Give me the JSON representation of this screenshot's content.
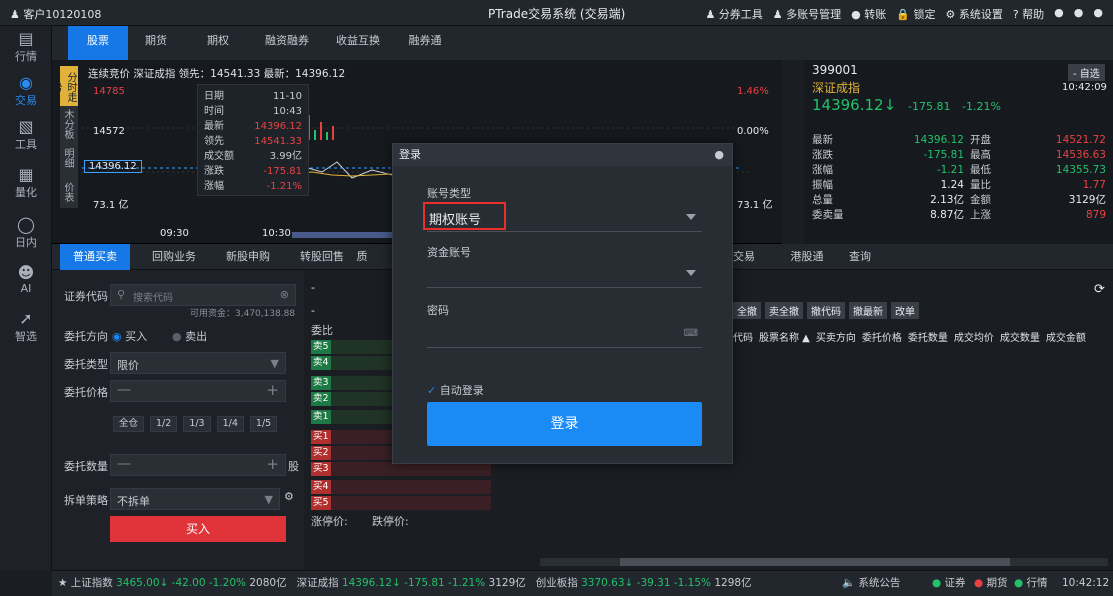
{
  "titlebar": {
    "account": "客户10120108",
    "title": "PTrade交易系统 (交易端)",
    "tools": [
      "分券工具",
      "多账号管理",
      "转账",
      "锁定",
      "系统设置",
      "帮助"
    ]
  },
  "nav": {
    "items": [
      {
        "label": "行情",
        "icon": "chart-icon"
      },
      {
        "label": "交易",
        "icon": "trade-icon"
      },
      {
        "label": "工具",
        "icon": "toolbox-icon"
      },
      {
        "label": "量化",
        "icon": "quant-icon"
      },
      {
        "label": "日内",
        "icon": "intraday-icon"
      },
      {
        "label": "AI",
        "icon": "ai-icon"
      },
      {
        "label": "智选",
        "icon": "smart-icon"
      }
    ]
  },
  "tabs": [
    "股票",
    "期货",
    "期权",
    "融资融券",
    "收益互换",
    "融券通"
  ],
  "chart": {
    "header": "连续竞价  深证成指  领先：14541.33  最新：14396.12",
    "vtabs": [
      "分时走势",
      "木分板",
      "明细",
      "价表"
    ],
    "levels": {
      "high": "14785",
      "mid": "14572",
      "cur": "14396.12",
      "vol": "73.1 亿",
      "pct_high": "1.46%",
      "pct_mid": "0.00%",
      "pct_cur": "1.21%",
      "vol_r": "73.1 亿"
    },
    "times": [
      "09:30",
      "10:30"
    ]
  },
  "tooltip": {
    "rows": [
      [
        "日期",
        "11-10"
      ],
      [
        "时间",
        "10:43"
      ],
      [
        "最新",
        "14396.12"
      ],
      [
        "领先",
        "14541.33"
      ],
      [
        "成交额",
        "3.99亿"
      ],
      [
        "涨跌",
        "-175.81"
      ],
      [
        "涨幅",
        "-1.21%"
      ]
    ]
  },
  "quote": {
    "code": "399001",
    "name": "深证成指",
    "btn": "- 自选",
    "time": "10:42:09",
    "price": "14396.12↓",
    "change": "-175.81",
    "pct": "-1.21%",
    "rows": [
      [
        "最新",
        "14396.12",
        "开盘",
        "14521.72"
      ],
      [
        "涨跌",
        "-175.81",
        "最高",
        "14536.63"
      ],
      [
        "涨幅",
        "-1.21",
        "最低",
        "14355.73"
      ],
      [
        "振幅",
        "1.24",
        "量比",
        "1.77"
      ],
      [
        "总量",
        "2.13亿",
        "金额",
        "3129亿"
      ],
      [
        "委卖量",
        "8.87亿",
        "上涨",
        "879"
      ]
    ]
  },
  "ordertabs": [
    "普通买卖",
    "回购业务",
    "新股申购",
    "转股回售",
    "质",
    "交易",
    "港股通",
    "查询"
  ],
  "form": {
    "code_label": "证券代码",
    "search_placeholder": "搜索代码",
    "avail": "可用资金：3,470,138.88",
    "dir_label": "委托方向",
    "buy": "买入",
    "sell": "卖出",
    "type_label": "委托类型",
    "type_value": "限价",
    "price_label": "委托价格",
    "fractions": [
      "全仓",
      "1/2",
      "1/3",
      "1/4",
      "1/5"
    ],
    "qty_label": "委托数量",
    "unit": "股",
    "split_label": "拆单策略",
    "split_value": "不拆单",
    "submit": "买入"
  },
  "book": {
    "ratio": "委比",
    "sells": [
      "卖5",
      "卖4",
      "卖3",
      "卖2",
      "卖1"
    ],
    "buys": [
      "买1",
      "买2",
      "买3",
      "买4",
      "买5"
    ],
    "limit_up": "涨停价:",
    "limit_down": "跌停价:",
    "dash": "-"
  },
  "table": {
    "actions": [
      "全撤",
      "卖全撤",
      "撤代码",
      "撤最新",
      "改单"
    ],
    "headers": [
      "代码",
      "股票名称",
      "买卖方向",
      "委托价格",
      "委托数量",
      "成交均价",
      "成交数量",
      "成交金额"
    ]
  },
  "dialog": {
    "title": "登录",
    "acct_type_label": "账号类型",
    "acct_type_value": "期权账号",
    "fund_label": "资金账号",
    "pwd_label": "密码",
    "auto": "自动登录",
    "login": "登录"
  },
  "status": {
    "idx1": "上证指数",
    "v1": "3465.00↓ -42.00 -1.20%",
    "a1": "2080亿",
    "idx2": "深证成指",
    "v2": "14396.12↓ -175.81 -1.21%",
    "a2": "3129亿",
    "idx3": "创业板指",
    "v3": "3370.63↓ -39.31 -1.15%",
    "a3": "1298亿",
    "notice": "系统公告",
    "s1": "证券",
    "s2": "期货",
    "s3": "行情",
    "time": "10:42:12"
  }
}
